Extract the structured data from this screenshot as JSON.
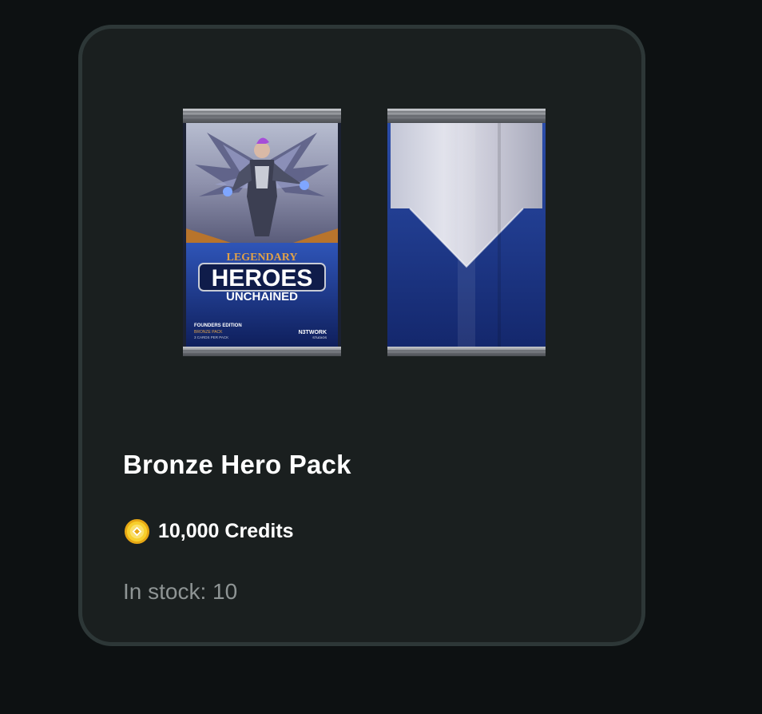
{
  "product": {
    "title": "Bronze Hero Pack",
    "price_label": "10,000 Credits",
    "stock_label": "In stock: 10",
    "currency_icon": "credit-coin-icon"
  },
  "pack_art": {
    "logo_top": "LEGENDARY",
    "logo_main": "HEROES",
    "logo_sub": "UNCHAINED",
    "edition": "FOUNDERS EDITION",
    "pack_type": "BRONZE PACK",
    "cards_per_pack": "3 CARDS PER PACK",
    "studio": "N3TWORK",
    "studio_sub": "STUDIOS"
  },
  "colors": {
    "background": "#0d1112",
    "card": "#1a1f1f",
    "card_border": "#2d3737",
    "coin": "#f3c11b",
    "pack_blue": "#1f3c96"
  }
}
